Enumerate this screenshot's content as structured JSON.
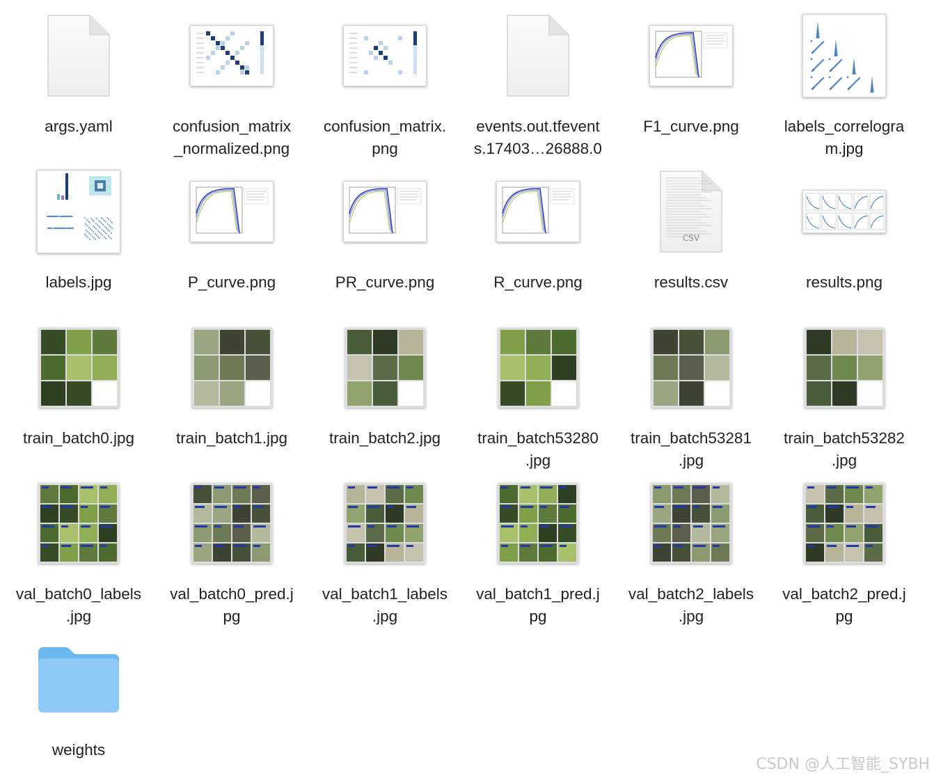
{
  "files": [
    {
      "name": "args.yaml",
      "kind": "document",
      "icon": "document-icon"
    },
    {
      "name": "confusion_matrix\n_normalized.png",
      "kind": "matrix",
      "icon": "chart-thumbnail-icon"
    },
    {
      "name": "confusion_matrix.\npng",
      "kind": "matrix",
      "icon": "chart-thumbnail-icon"
    },
    {
      "name": "events.out.tfevent\ns.17403…26888.0",
      "kind": "document",
      "icon": "document-icon"
    },
    {
      "name": "F1_curve.png",
      "kind": "curve",
      "icon": "chart-thumbnail-icon"
    },
    {
      "name": "labels_correlogra\nm.jpg",
      "kind": "correlogram",
      "icon": "chart-thumbnail-icon"
    },
    {
      "name": "labels.jpg",
      "kind": "labels",
      "icon": "chart-thumbnail-icon"
    },
    {
      "name": "P_curve.png",
      "kind": "curve",
      "icon": "chart-thumbnail-icon"
    },
    {
      "name": "PR_curve.png",
      "kind": "curve",
      "icon": "chart-thumbnail-icon"
    },
    {
      "name": "R_curve.png",
      "kind": "curve",
      "icon": "chart-thumbnail-icon"
    },
    {
      "name": "results.csv",
      "kind": "csv",
      "icon": "csv-document-icon",
      "badge": "CSV"
    },
    {
      "name": "results.png",
      "kind": "results",
      "icon": "chart-thumbnail-icon"
    },
    {
      "name": "train_batch0.jpg",
      "kind": "train",
      "icon": "image-thumbnail-icon"
    },
    {
      "name": "train_batch1.jpg",
      "kind": "train",
      "icon": "image-thumbnail-icon"
    },
    {
      "name": "train_batch2.jpg",
      "kind": "train",
      "icon": "image-thumbnail-icon"
    },
    {
      "name": "train_batch53280\n.jpg",
      "kind": "train",
      "icon": "image-thumbnail-icon"
    },
    {
      "name": "train_batch53281\n.jpg",
      "kind": "train",
      "icon": "image-thumbnail-icon"
    },
    {
      "name": "train_batch53282\n.jpg",
      "kind": "train",
      "icon": "image-thumbnail-icon"
    },
    {
      "name": "val_batch0_labels\n.jpg",
      "kind": "val",
      "icon": "image-thumbnail-icon"
    },
    {
      "name": "val_batch0_pred.j\npg",
      "kind": "val",
      "icon": "image-thumbnail-icon"
    },
    {
      "name": "val_batch1_labels\n.jpg",
      "kind": "val",
      "icon": "image-thumbnail-icon"
    },
    {
      "name": "val_batch1_pred.j\npg",
      "kind": "val",
      "icon": "image-thumbnail-icon"
    },
    {
      "name": "val_batch2_labels\n.jpg",
      "kind": "val",
      "icon": "image-thumbnail-icon"
    },
    {
      "name": "val_batch2_pred.j\npg",
      "kind": "val",
      "icon": "image-thumbnail-icon"
    },
    {
      "name": "weights",
      "kind": "folder",
      "icon": "folder-icon"
    }
  ],
  "watermark": "CSDN @人工智能_SYBH",
  "colors": {
    "folder": "#6bb7ef",
    "folder_light": "#8dcaf6",
    "accent_blue": "#1c3f7a",
    "leaf_dark": "#3c5a2a",
    "leaf_light": "#8bb35a"
  }
}
